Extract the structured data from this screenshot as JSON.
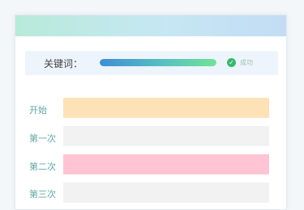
{
  "search": {
    "label": "关键词：",
    "progress": 1.0,
    "status": "成功"
  },
  "rows": [
    {
      "label": "开始",
      "color": "#fde2b8"
    },
    {
      "label": "第一次",
      "color": "#f2f2f2"
    },
    {
      "label": "第二次",
      "color": "#ffc5d5"
    },
    {
      "label": "第三次",
      "color": "#f2f2f2"
    }
  ],
  "colors": {
    "label_text": "#63a7a7",
    "success": "#38b86d"
  }
}
